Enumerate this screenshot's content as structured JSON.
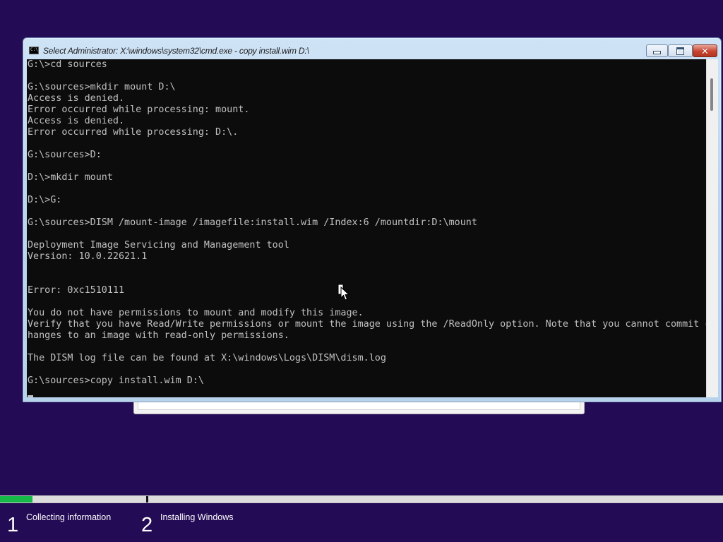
{
  "window": {
    "title": "Select Administrator: X:\\windows\\system32\\cmd.exe - copy  install.wim D:\\",
    "icon": "cmd-app-icon",
    "icon_text": "C:\\",
    "minimize_icon": "minimize-icon",
    "maximize_icon": "maximize-icon",
    "close_icon": "close-icon",
    "close_glyph": "✕"
  },
  "console": {
    "background": "#0c0c0c",
    "foreground": "#c0c0c0",
    "lines": [
      "G:\\>cd sources",
      "",
      "G:\\sources>mkdir mount D:\\",
      "Access is denied.",
      "Error occurred while processing: mount.",
      "Access is denied.",
      "Error occurred while processing: D:\\.",
      "",
      "G:\\sources>D:",
      "",
      "D:\\>mkdir mount",
      "",
      "D:\\>G:",
      "",
      "G:\\sources>DISM /mount-image /imagefile:install.wim /Index:6 /mountdir:D:\\mount",
      "",
      "Deployment Image Servicing and Management tool",
      "Version: 10.0.22621.1",
      "",
      "",
      "Error: 0xc1510111",
      "",
      "You do not have permissions to mount and modify this image.",
      "Verify that you have Read/Write permissions or mount the image using the /ReadOnly option. Note that you cannot commit c",
      "hanges to an image with read-only permissions.",
      "",
      "The DISM log file can be found at X:\\windows\\Logs\\DISM\\dism.log",
      "",
      "G:\\sources>copy install.wim D:\\"
    ]
  },
  "setup": {
    "background_color": "#230b55",
    "progress": {
      "fraction": 0.045,
      "color": "#16b84a"
    },
    "steps": [
      {
        "number": "1",
        "label": "Collecting information"
      },
      {
        "number": "2",
        "label": "Installing Windows"
      }
    ]
  },
  "pointer": {
    "icon": "mouse-pointer-icon"
  }
}
